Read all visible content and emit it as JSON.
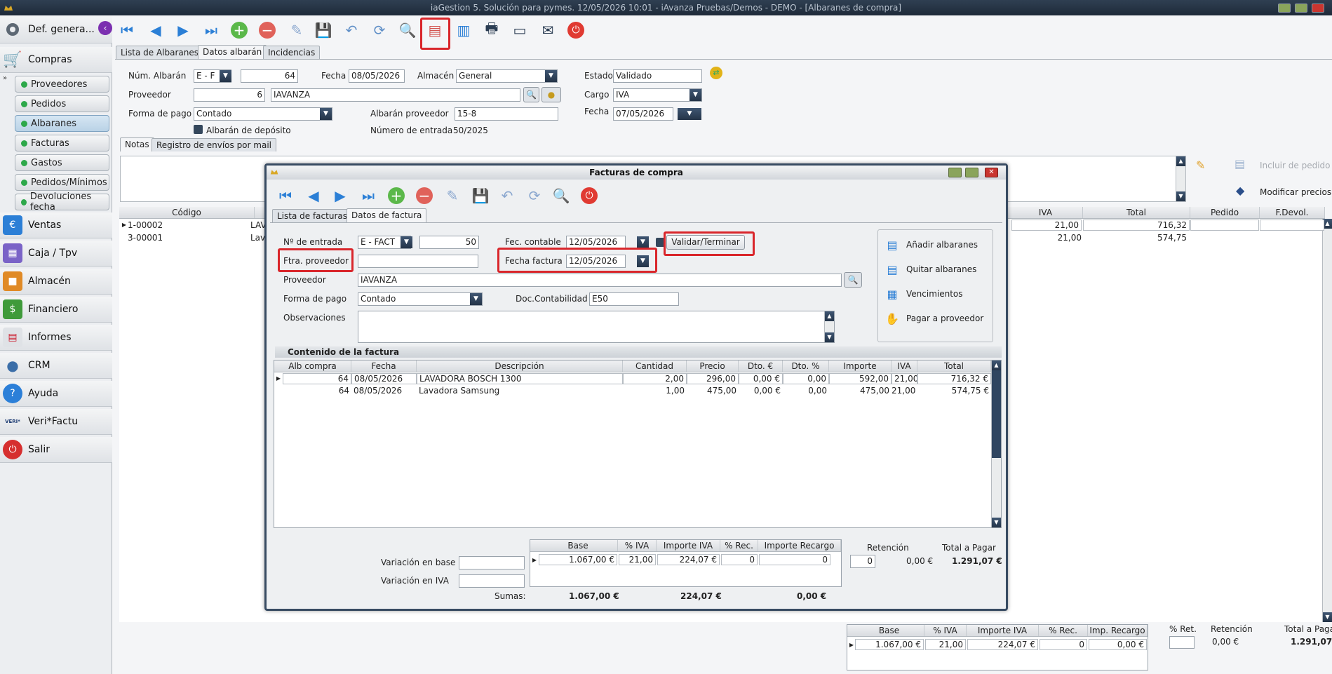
{
  "window": {
    "title": "iaGestion 5. Solución para pymes.  12/05/2026 10:01  -  iAvanza Pruebas/Demos - DEMO - [Albaranes de compra]"
  },
  "sidebar": {
    "top": {
      "label": "Def. genera..."
    },
    "main": [
      {
        "label": "Compras"
      },
      {
        "label": "Ventas"
      },
      {
        "label": "Caja / Tpv"
      },
      {
        "label": "Almacén"
      },
      {
        "label": "Financiero"
      },
      {
        "label": "Informes"
      },
      {
        "label": "CRM"
      },
      {
        "label": "Ayuda"
      },
      {
        "label": "Veri*Factu"
      },
      {
        "label": "Salir"
      }
    ],
    "sub": [
      {
        "label": "Proveedores"
      },
      {
        "label": "Pedidos"
      },
      {
        "label": "Albaranes"
      },
      {
        "label": "Facturas"
      },
      {
        "label": "Gastos"
      },
      {
        "label": "Pedidos/Mínimos"
      },
      {
        "label": "Devoluciones fecha"
      }
    ]
  },
  "tabs": [
    {
      "label": "Lista de Albaranes"
    },
    {
      "label": "Datos albarán"
    },
    {
      "label": "Incidencias"
    }
  ],
  "form": {
    "num_albaran_label": "Núm. Albarán",
    "serie": "E  - F",
    "num": "64",
    "fecha_label": "Fecha",
    "fecha": "08/05/2026",
    "almacen_label": "Almacén",
    "almacen": "General",
    "estado_label": "Estado",
    "estado": "Validado",
    "proveedor_label": "Proveedor",
    "proveedor_code": "6",
    "proveedor_name": "IAVANZA",
    "cargo_label": "Cargo",
    "cargo": "IVA",
    "forma_pago_label": "Forma de pago",
    "forma_pago": "Contado",
    "albaran_prov_label": "Albarán proveedor",
    "albaran_prov": "15-8",
    "fecha2_label": "Fecha",
    "fecha2": "07/05/2026",
    "deposito_label": "Albarán de depósito",
    "num_entrada_label": "Número de entrada",
    "num_entrada": "50/2025"
  },
  "notes_tabs": [
    {
      "label": "Notas"
    },
    {
      "label": "Registro de envíos por mail"
    }
  ],
  "right_actions": {
    "incluir": "Incluir de pedido",
    "modificar": "Modificar precios"
  },
  "bg_grid": {
    "headers": {
      "codigo": "Código",
      "iva": "IVA",
      "total": "Total",
      "pedido": "Pedido",
      "fdevol": "F.Devol."
    },
    "rows": [
      {
        "codigo": "1-00002",
        "desc": "LAV",
        "iva": "21,00",
        "total": "716,32"
      },
      {
        "codigo": "3-00001",
        "desc": "Lav",
        "iva": "21,00",
        "total": "574,75"
      }
    ]
  },
  "bg_totals": {
    "headers": [
      "Base",
      "% IVA",
      "Importe IVA",
      "% Rec.",
      "Imp. Recargo"
    ],
    "values": [
      "1.067,00 €",
      "21,00",
      "224,07 €",
      "0",
      "0,00 €"
    ],
    "ret_label": "% Ret.",
    "retencion_label": "Retención",
    "retencion": "0,00 €",
    "total_label": "Total a Pagar",
    "total": "1.291,07"
  },
  "dialog": {
    "title": "Facturas de compra",
    "tabs": [
      {
        "label": "Lista de facturas"
      },
      {
        "label": "Datos de factura"
      }
    ],
    "num_entrada_label": "Nº de entrada",
    "serie": "E  - FACT",
    "num": "50",
    "fec_contable_label": "Fec. contable",
    "fec_contable": "12/05/2026",
    "validar_label": "Validar/Terminar",
    "ftra_label": "Ftra. proveedor",
    "ftra": "",
    "fecha_factura_label": "Fecha factura",
    "fecha_factura": "12/05/2026",
    "proveedor_label": "Proveedor",
    "proveedor": "IAVANZA",
    "forma_pago_label": "Forma de pago",
    "forma_pago": "Contado",
    "doc_label": "Doc.Contabilidad",
    "doc": "E50",
    "obs_label": "Observaciones",
    "actions": [
      {
        "label": "Añadir albaranes"
      },
      {
        "label": "Quitar albaranes"
      },
      {
        "label": "Vencimientos"
      },
      {
        "label": "Pagar a proveedor"
      }
    ],
    "content_title": "Contenido de la factura",
    "headers": [
      "Alb compra",
      "Fecha",
      "Descripción",
      "Cantidad",
      "Precio",
      "Dto. €",
      "Dto. %",
      "Importe",
      "IVA",
      "Total"
    ],
    "rows": [
      {
        "alb": "64",
        "fecha": "08/05/2026",
        "desc": "LAVADORA BOSCH 1300",
        "cant": "2,00",
        "precio": "296,00",
        "dto_e": "0,00 €",
        "dto_p": "0,00",
        "importe": "592,00",
        "iva": "21,00",
        "total": "716,32 €"
      },
      {
        "alb": "64",
        "fecha": "08/05/2026",
        "desc": "Lavadora Samsung",
        "cant": "1,00",
        "precio": "475,00",
        "dto_e": "0,00 €",
        "dto_p": "0,00",
        "importe": "475,00",
        "iva": "21,00",
        "total": "574,75 €"
      }
    ],
    "var_base_label": "Variación en base",
    "var_iva_label": "Variación en IVA",
    "tot_headers": [
      "Base",
      "% IVA",
      "Importe IVA",
      "% Rec.",
      "Importe Recargo"
    ],
    "tot_values": [
      "1.067,00 €",
      "21,00",
      "224,07 €",
      "0",
      "0"
    ],
    "retencion_label": "Retención",
    "retencion_input": "0",
    "retencion": "0,00 €",
    "total_label": "Total a Pagar",
    "total": "1.291,07 €",
    "sumas_label": "Sumas:",
    "sumas_base": "1.067,00 €",
    "sumas_iva": "224,07 €",
    "sumas_rec": "0,00 €"
  },
  "colors": {
    "red_highlight": "#d9262b",
    "navy": "#2a3c52",
    "green": "#2da84a"
  }
}
